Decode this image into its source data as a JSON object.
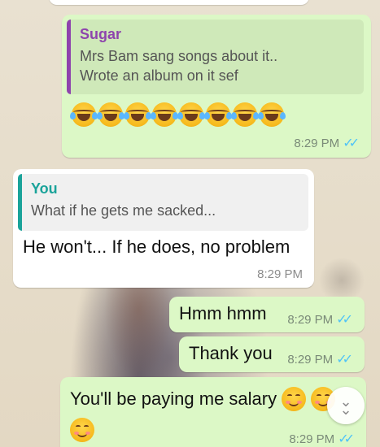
{
  "colors": {
    "outgoing_bubble": "#dcf8c6",
    "incoming_bubble": "#ffffff",
    "sugar_quote_bar": "#8e44ad",
    "you_quote_bar": "#1aa39a",
    "read_tick": "#4fc3f7"
  },
  "messages": [
    {
      "direction": "outgoing",
      "quote": {
        "author": "Sugar",
        "text_line1": "Mrs Bam sang songs about it..",
        "text_line2": "Wrote an album on it sef"
      },
      "emoji": [
        "rolling-on-floor-laughing",
        "rolling-on-floor-laughing",
        "rolling-on-floor-laughing",
        "rolling-on-floor-laughing",
        "rolling-on-floor-laughing",
        "rolling-on-floor-laughing",
        "rolling-on-floor-laughing",
        "rolling-on-floor-laughing"
      ],
      "time": "8:29 PM",
      "status_icon": "double-check-read-icon"
    },
    {
      "direction": "incoming",
      "quote": {
        "author": "You",
        "text": "What if he gets me sacked..."
      },
      "text": "He won't... If he does, no problem",
      "time": "8:29 PM"
    },
    {
      "direction": "outgoing",
      "text": "Hmm hmm",
      "time": "8:29 PM",
      "status_icon": "double-check-read-icon"
    },
    {
      "direction": "outgoing",
      "text": "Thank you",
      "time": "8:29 PM",
      "status_icon": "double-check-read-icon"
    },
    {
      "direction": "outgoing",
      "text": "You'll be paying me salary",
      "emoji": [
        "smiling-face-with-smiling-eyes",
        "smiling-face-with-smiling-eyes",
        "smiling-face-with-smiling-eyes"
      ],
      "time": "8:29 PM",
      "status_icon": "double-check-read-icon"
    }
  ],
  "scroll_button": {
    "icon": "double-chevron-down-icon"
  }
}
